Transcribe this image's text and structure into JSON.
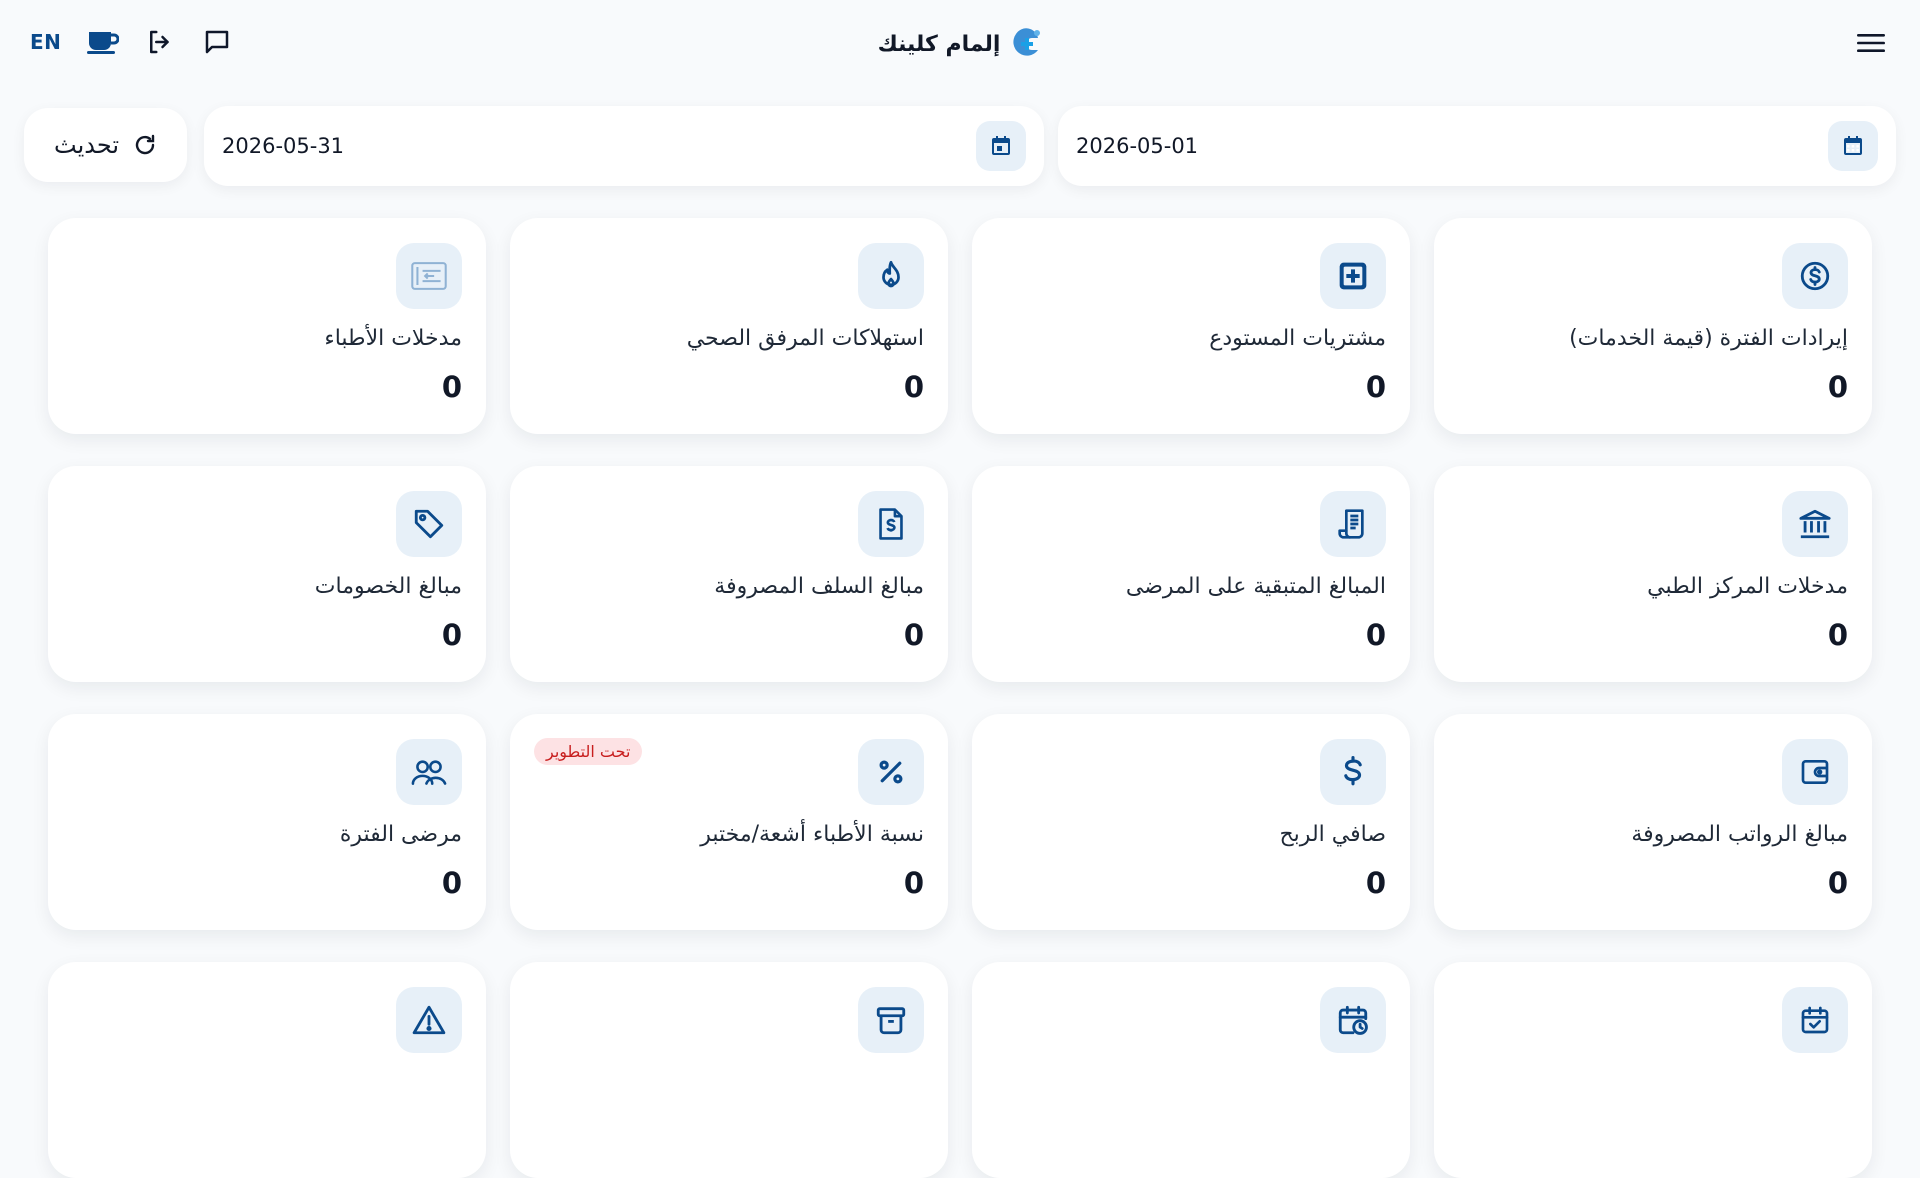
{
  "header": {
    "lang_label": "EN",
    "brand_name": "إلمام كلينك"
  },
  "filters": {
    "start_date": "2026-05-01",
    "end_date": "2026-05-31",
    "refresh_label": "تحديث"
  },
  "cards": [
    {
      "title": "إيرادات الفترة (قيمة الخدمات)",
      "value": "0",
      "icon": "dollar-circle-icon"
    },
    {
      "title": "مشتريات المستودع",
      "value": "0",
      "icon": "plus-square-icon"
    },
    {
      "title": "استهلاكات المرفق الصحي",
      "value": "0",
      "icon": "fire-icon"
    },
    {
      "title": "مدخلات الأطباء",
      "value": "0",
      "icon": "doctor-entry-icon"
    },
    {
      "title": "مدخلات المركز الطبي",
      "value": "0",
      "icon": "bank-icon"
    },
    {
      "title": "المبالغ المتبقية على المرضى",
      "value": "0",
      "icon": "receipt-icon"
    },
    {
      "title": "مبالغ السلف المصروفة",
      "value": "0",
      "icon": "invoice-dollar-icon"
    },
    {
      "title": "مبالغ الخصومات",
      "value": "0",
      "icon": "tag-icon"
    },
    {
      "title": "مبالغ الرواتب المصروفة",
      "value": "0",
      "icon": "wallet-icon"
    },
    {
      "title": "صافي الربح",
      "value": "0",
      "icon": "dollar-icon"
    },
    {
      "title": "نسبة الأطباء أشعة/مختبر",
      "value": "0",
      "icon": "percent-icon",
      "badge": "تحت التطوير"
    },
    {
      "title": "مرضى الفترة",
      "value": "0",
      "icon": "users-icon"
    },
    {
      "title": "",
      "value": "",
      "icon": "calendar-check-icon"
    },
    {
      "title": "",
      "value": "",
      "icon": "calendar-clock-icon"
    },
    {
      "title": "",
      "value": "",
      "icon": "archive-icon"
    },
    {
      "title": "",
      "value": "",
      "icon": "warning-icon"
    }
  ],
  "colors": {
    "accent": "#0b4a8b",
    "icon_bg": "#e7f0f8",
    "badge_bg": "#fde2e4",
    "badge_text": "#c81e1e",
    "background": "#f8fafc"
  }
}
